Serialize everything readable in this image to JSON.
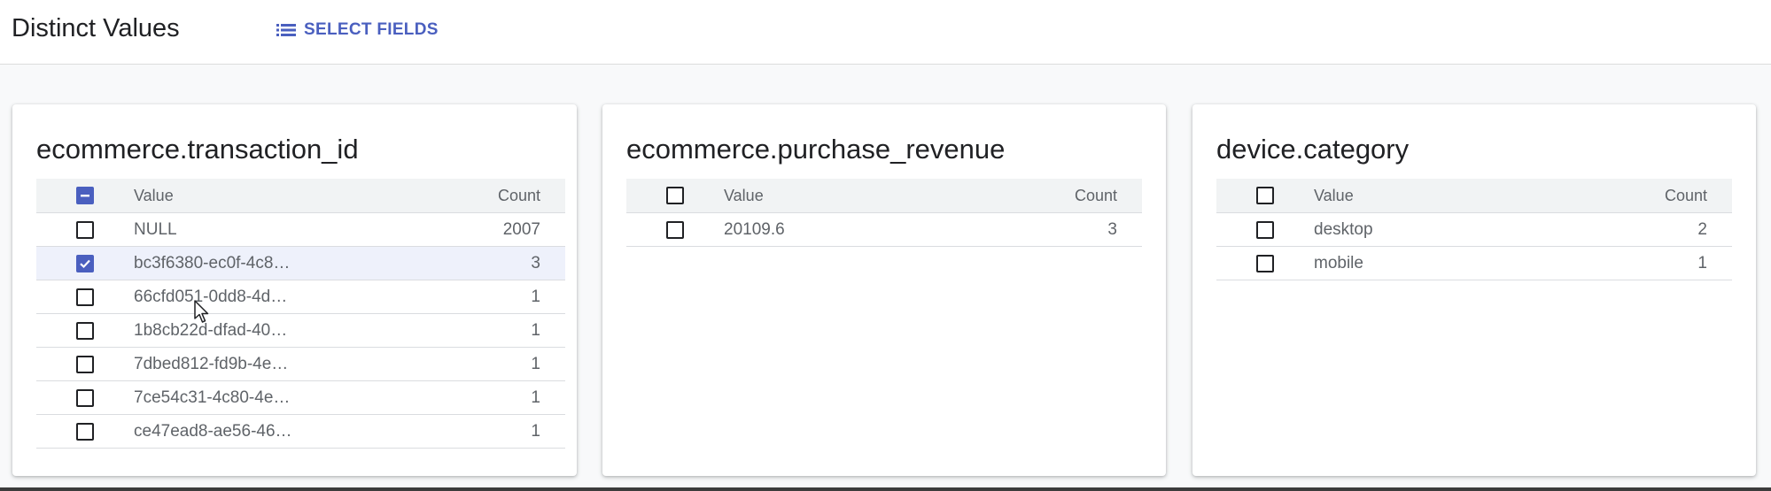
{
  "header": {
    "title": "Distinct Values",
    "select_fields_label": "SELECT FIELDS",
    "select_fields_icon": "list-icon"
  },
  "colors": {
    "accent": "#4a5fbf",
    "selected_row": "#eef1fb"
  },
  "cards": [
    {
      "title": "ecommerce.transaction_id",
      "header": {
        "value": "Value",
        "count": "Count",
        "checkbox_state": "indeterminate"
      },
      "rows": [
        {
          "value": "NULL",
          "count": "2007",
          "checked": false
        },
        {
          "value": "bc3f6380-ec0f-4c8…",
          "count": "3",
          "checked": true
        },
        {
          "value": "66cfd051-0dd8-4d…",
          "count": "1",
          "checked": false
        },
        {
          "value": "1b8cb22d-dfad-40…",
          "count": "1",
          "checked": false
        },
        {
          "value": "7dbed812-fd9b-4e…",
          "count": "1",
          "checked": false
        },
        {
          "value": "7ce54c31-4c80-4e…",
          "count": "1",
          "checked": false
        },
        {
          "value": "ce47ead8-ae56-46…",
          "count": "1",
          "checked": false
        }
      ]
    },
    {
      "title": "ecommerce.purchase_revenue",
      "header": {
        "value": "Value",
        "count": "Count",
        "checkbox_state": "unchecked"
      },
      "rows": [
        {
          "value": "20109.6",
          "count": "3",
          "checked": false
        }
      ]
    },
    {
      "title": "device.category",
      "header": {
        "value": "Value",
        "count": "Count",
        "checkbox_state": "unchecked"
      },
      "rows": [
        {
          "value": "desktop",
          "count": "2",
          "checked": false
        },
        {
          "value": "mobile",
          "count": "1",
          "checked": false
        }
      ]
    }
  ]
}
